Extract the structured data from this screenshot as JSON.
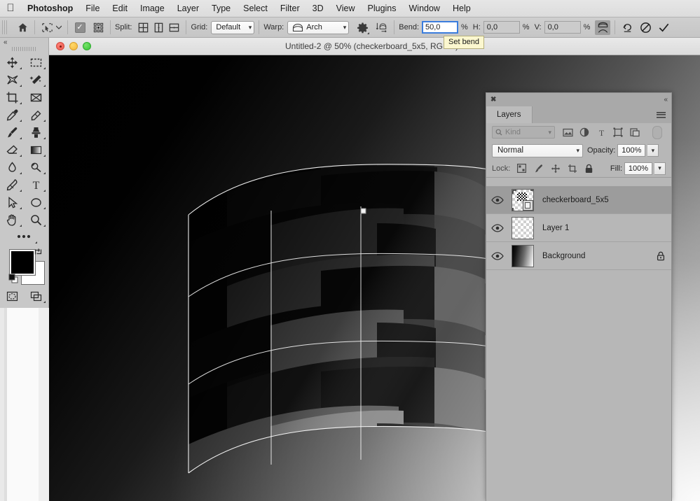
{
  "menubar": {
    "apple_icon": "apple-logo-icon",
    "items": [
      {
        "label": "Photoshop",
        "bold": true
      },
      {
        "label": "File"
      },
      {
        "label": "Edit"
      },
      {
        "label": "Image"
      },
      {
        "label": "Layer"
      },
      {
        "label": "Type"
      },
      {
        "label": "Select"
      },
      {
        "label": "Filter"
      },
      {
        "label": "3D"
      },
      {
        "label": "View"
      },
      {
        "label": "Plugins"
      },
      {
        "label": "Window"
      },
      {
        "label": "Help"
      }
    ]
  },
  "options_bar": {
    "home_icon": "home-icon",
    "tool_preset_icon": "warp-tool-preset-icon",
    "checkbox_checked": true,
    "reference_point_icon": "reference-point-icon",
    "split_label": "Split:",
    "split_buttons": [
      "split-crosswise-icon",
      "split-vertical-icon",
      "split-horizontal-icon"
    ],
    "grid_label": "Grid:",
    "grid_value": "Default",
    "warp_label": "Warp:",
    "warp_value": "Arch",
    "warp_settings_icon": "gear-icon",
    "warp_orientation_icon": "change-warp-orientation-icon",
    "bend_label": "Bend:",
    "bend_value": "50,0",
    "bend_unit": "%",
    "h_label": "H:",
    "h_value": "0,0",
    "h_unit": "%",
    "v_label": "V:",
    "v_value": "0,0",
    "v_unit": "%",
    "toggle_warp_icon": "toggle-warp-icon",
    "reset_icon": "reset-icon",
    "cancel_icon": "cancel-icon",
    "commit_icon": "commit-checkmark-icon"
  },
  "tooltip": {
    "text": "Set bend"
  },
  "document": {
    "title": "Untitled-2 @ 50% (checkerboard_5x5, RGB/8) *",
    "zoom": "50%",
    "name": "Untitled-2",
    "layer_in_title": "checkerboard_5x5",
    "mode": "RGB/8",
    "modified_marker": "*",
    "traffic_lights": [
      "close-button",
      "minimize-button",
      "zoom-button"
    ]
  },
  "toolbar": {
    "collapse_icon": "collapse-panel-icon",
    "tools": [
      {
        "name": "move-tool",
        "has_flyout": true
      },
      {
        "name": "rectangular-marquee-tool",
        "has_flyout": true
      },
      {
        "name": "lasso-tool",
        "has_flyout": true
      },
      {
        "name": "quick-selection-tool",
        "has_flyout": true
      },
      {
        "name": "crop-tool",
        "has_flyout": true
      },
      {
        "name": "frame-tool",
        "has_flyout": false
      },
      {
        "name": "eyedropper-tool",
        "has_flyout": true
      },
      {
        "name": "healing-brush-tool",
        "has_flyout": true
      },
      {
        "name": "brush-tool",
        "has_flyout": true
      },
      {
        "name": "clone-stamp-tool",
        "has_flyout": true
      },
      {
        "name": "eraser-tool",
        "has_flyout": true
      },
      {
        "name": "gradient-tool",
        "has_flyout": true
      },
      {
        "name": "blur-tool",
        "has_flyout": true
      },
      {
        "name": "dodge-tool",
        "has_flyout": true
      },
      {
        "name": "pen-tool",
        "has_flyout": true
      },
      {
        "name": "type-tool",
        "has_flyout": true
      },
      {
        "name": "path-selection-tool",
        "has_flyout": true
      },
      {
        "name": "ellipse-tool",
        "has_flyout": true
      },
      {
        "name": "hand-tool",
        "has_flyout": true
      },
      {
        "name": "zoom-tool",
        "has_flyout": true
      }
    ],
    "edit_toolbar_icon": "edit-toolbar-ellipsis-icon",
    "foreground_color": "#000000",
    "background_color": "#ffffff",
    "swap_colors_icon": "swap-colors-icon",
    "default_colors_icon": "default-colors-icon",
    "quick_mask_icon": "quick-mask-icon",
    "screen_mode_icon": "screen-mode-icon"
  },
  "layers_panel": {
    "close_icon": "close-icon",
    "collapse_icon": "collapse-to-icons-icon",
    "tab_label": "Layers",
    "menu_icon": "panel-menu-icon",
    "filter": {
      "search_icon": "search-icon",
      "kind_label": "Kind",
      "filter_icons": [
        "filter-pixel-icon",
        "filter-adjustment-icon",
        "filter-type-icon",
        "filter-shape-icon",
        "filter-smart-object-icon"
      ],
      "toggle_icon": "filter-toggle-pill"
    },
    "blend_mode": "Normal",
    "opacity_label": "Opacity:",
    "opacity_value": "100%",
    "lock_label": "Lock:",
    "lock_buttons": [
      "lock-transparent-pixels-icon",
      "lock-image-pixels-icon",
      "lock-position-icon",
      "lock-artboard-nesting-icon",
      "lock-all-icon"
    ],
    "fill_label": "Fill:",
    "fill_value": "100%",
    "layers": [
      {
        "name": "checkerboard_5x5",
        "visible": true,
        "selected": true,
        "thumbnail": "smart-object-checkerboard-thumbnail",
        "locked": false,
        "eye_icon": "eye-icon"
      },
      {
        "name": "Layer 1",
        "visible": true,
        "selected": false,
        "thumbnail": "transparent-checker-thumbnail",
        "locked": false,
        "eye_icon": "eye-icon"
      },
      {
        "name": "Background",
        "visible": true,
        "selected": false,
        "thumbnail": "gradient-thumbnail",
        "locked": true,
        "lock_icon": "lock-icon",
        "eye_icon": "eye-icon"
      }
    ]
  },
  "canvas": {
    "warp_type": "Arch",
    "bend_percent": 50,
    "grid_preset": "Default",
    "handle_position": "top-center",
    "background_description": "diagonal black-to-white gradient",
    "warped_content": "checkerboard_5x5"
  },
  "colors": {
    "chrome": "#c8c8c8",
    "panel": "#b7b7b7",
    "panel_selected": "#9c9c9c",
    "accent_focus": "#3b7ddd",
    "tooltip_bg": "#fbf7cf",
    "menubar": "#e6e6e6"
  }
}
